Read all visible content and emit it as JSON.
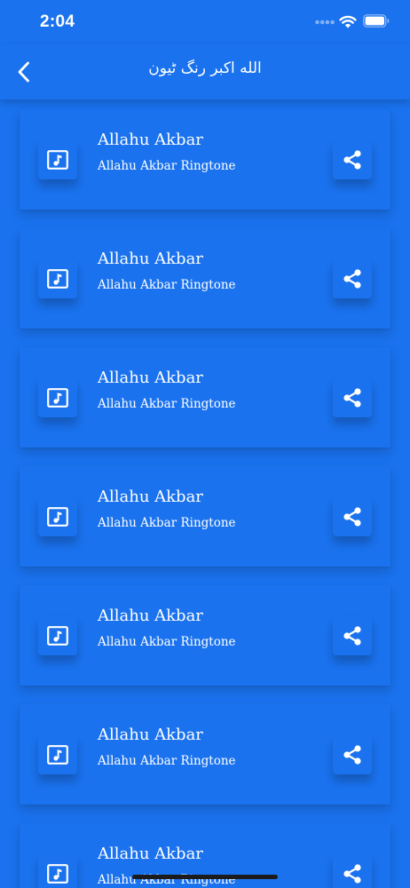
{
  "status_bar": {
    "time": "2:04"
  },
  "nav": {
    "title": "الله اکبر رنگ ٹیون",
    "back_icon": "chevron-left-icon"
  },
  "list": {
    "items": [
      {
        "title": "Allahu Akbar",
        "subtitle": "Allahu Akbar Ringtone"
      },
      {
        "title": "Allahu Akbar",
        "subtitle": "Allahu Akbar Ringtone"
      },
      {
        "title": "Allahu Akbar",
        "subtitle": "Allahu Akbar Ringtone"
      },
      {
        "title": "Allahu Akbar",
        "subtitle": "Allahu Akbar Ringtone"
      },
      {
        "title": "Allahu Akbar",
        "subtitle": "Allahu Akbar Ringtone"
      },
      {
        "title": "Allahu Akbar",
        "subtitle": "Allahu Akbar Ringtone"
      },
      {
        "title": "Allahu Akbar",
        "subtitle": "Allahu Akbar Ringtone"
      }
    ],
    "item_icon": "music-note-icon",
    "share_icon": "share-icon"
  },
  "colors": {
    "background": "#1a72ee",
    "text": "#ffffff"
  }
}
